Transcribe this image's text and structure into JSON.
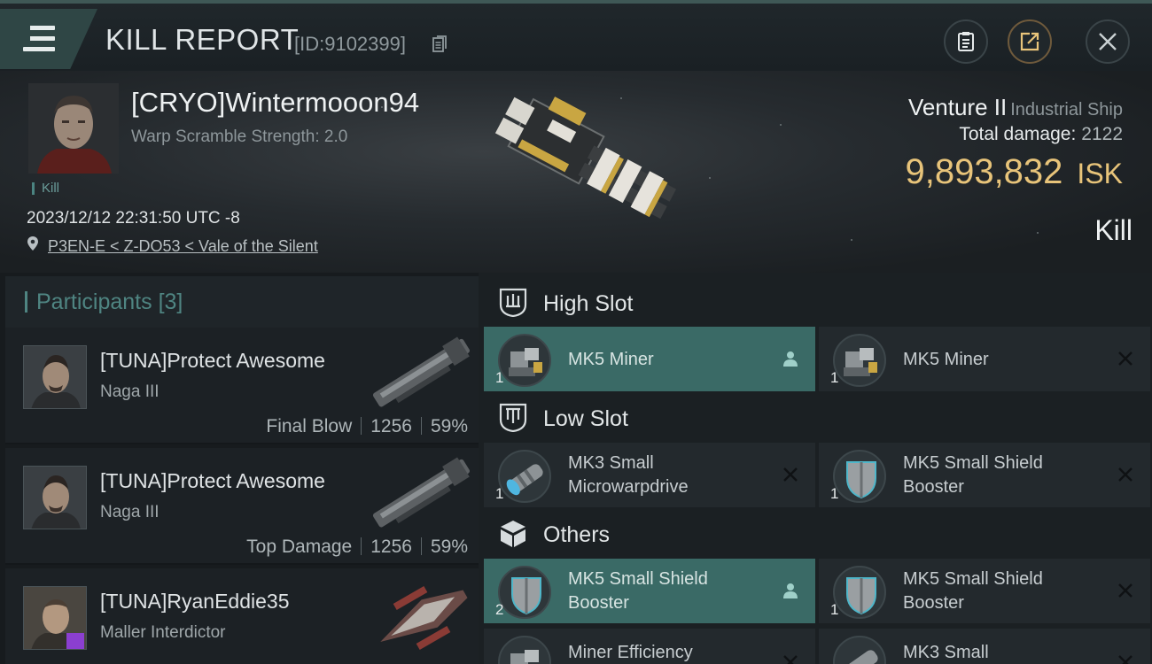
{
  "header": {
    "title": "KILL REPORT",
    "report_id": "[ID:9102399]",
    "icons": {
      "menu": "hamburger-menu-icon",
      "copy": "copy-icon",
      "doc": "clipboard-icon",
      "share": "share-icon",
      "close": "close-icon"
    }
  },
  "victim": {
    "name": "[CRYO]Wintermooon94",
    "warp_scramble": "Warp Scramble Strength: 2.0",
    "tag": "Kill",
    "datetime": "2023/12/12 22:31:50 UTC -8",
    "location": "P3EN-E < Z-DO53 < Vale of the Silent",
    "ship_name": "Venture II",
    "ship_type": "Industrial Ship",
    "total_damage_label": "Total damage:",
    "total_damage": "2122",
    "isk_value": "9,893,832",
    "isk_unit": "ISK",
    "result": "Kill"
  },
  "participants": {
    "label": "Participants",
    "count": "[3]",
    "rows": [
      {
        "name": "[TUNA]Protect Awesome",
        "ship": "Naga III",
        "role": "Final Blow",
        "damage": "1256",
        "percent": "59%"
      },
      {
        "name": "[TUNA]Protect Awesome",
        "ship": "Naga III",
        "role": "Top Damage",
        "damage": "1256",
        "percent": "59%"
      },
      {
        "name": "[TUNA]RyanEddie35",
        "ship": "Maller Interdictor"
      }
    ]
  },
  "fitting": {
    "high_slot": {
      "label": "High Slot",
      "items": [
        {
          "name": "MK5 Miner",
          "qty": "1",
          "status": "fitted"
        },
        {
          "name": "MK5 Miner",
          "qty": "1",
          "status": "destroyed"
        }
      ]
    },
    "low_slot": {
      "label": "Low Slot",
      "items": [
        {
          "name": "MK3 Small Microwarpdrive",
          "qty": "1",
          "status": "destroyed"
        },
        {
          "name": "MK5 Small Shield Booster",
          "qty": "1",
          "status": "destroyed"
        }
      ]
    },
    "others": {
      "label": "Others",
      "items": [
        {
          "name": "MK5 Small Shield Booster",
          "qty": "2",
          "status": "fitted"
        },
        {
          "name": "MK5 Small Shield Booster",
          "qty": "1",
          "status": "destroyed"
        },
        {
          "name": "Miner Efficiency",
          "qty": "",
          "status": "destroyed"
        },
        {
          "name": "MK3 Small",
          "qty": "",
          "status": "destroyed"
        }
      ]
    }
  },
  "colors": {
    "accent_teal": "#3a6a66",
    "isk_gold": "#e8c47a",
    "badge_purple": "#8b3fd0"
  }
}
